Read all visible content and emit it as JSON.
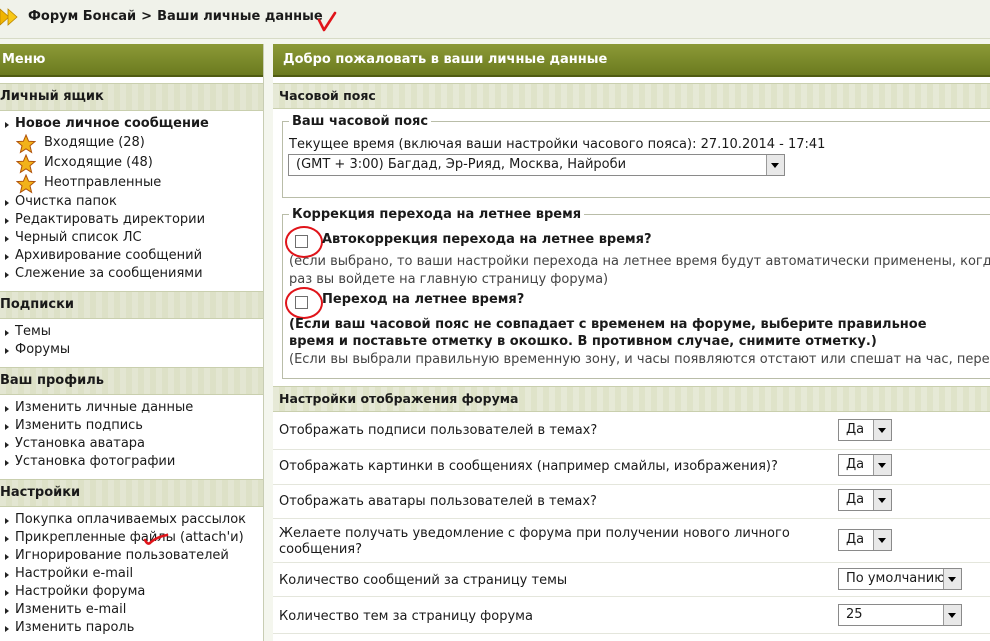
{
  "breadcrumb": {
    "forum": "Форум Бонсай",
    "separator": ">",
    "current": "Ваши личные данные"
  },
  "sidebar": {
    "title": "Меню",
    "sections": [
      {
        "title": "Личный ящик",
        "items": [
          "Новое личное сообщение",
          "Входящие (28)",
          "Исходящие (48)",
          "Неотправленные",
          "Очистка папок",
          "Редактировать директории",
          "Черный список ЛС",
          "Архивирование сообщений",
          "Слежение за сообщениями"
        ]
      },
      {
        "title": "Подписки",
        "items": [
          "Темы",
          "Форумы"
        ]
      },
      {
        "title": "Ваш профиль",
        "items": [
          "Изменить личные данные",
          "Изменить подпись",
          "Установка аватара",
          "Установка фотографии"
        ]
      },
      {
        "title": "Настройки",
        "items": [
          "Покупка оплачиваемых рассылок",
          "Прикрепленные файлы (attach'и)",
          "Игнорирование пользователей",
          "Настройки e-mail",
          "Настройки форума",
          "Изменить e-mail",
          "Изменить пароль"
        ]
      }
    ]
  },
  "main": {
    "title": "Добро пожаловать в ваши личные данные",
    "timezone_section": "Часовой пояс",
    "timezone_legend": "Ваш часовой пояс",
    "current_time": "Текущее время (включая ваши настройки часового пояса): 27.10.2014 - 17:41",
    "timezone_value": "(GMT + 3:00) Багдад, Эр-Рияд, Москва, Найроби",
    "dst_legend": "Коррекция перехода на летнее время",
    "auto_dst_label": "Автокоррекция перехода на летнее время?",
    "auto_dst_hint_1": "(если выбрано, то ваши настройки перехода на летнее время будут автоматически применены, когда в сле",
    "auto_dst_hint_2": "раз вы войдете на главную страницу форума)",
    "dst_label": "Переход на летнее время?",
    "dst_note_1": "(Если ваш часовой пояс не совпадает с временем на форуме, выберите правильное",
    "dst_note_2": "время и поставьте отметку в окошко. В противном случае, снимите отметку.)",
    "dst_hint": "(Если вы выбрали правильную временную зону, и часы появляются отстают или спешат на час, перепровер",
    "display_section": "Настройки отображения форума",
    "settings": [
      {
        "label": "Отображать подписи пользователей в темах?",
        "value": "Да"
      },
      {
        "label": "Отображать картинки в сообщениях (например смайлы, изображения)?",
        "value": "Да"
      },
      {
        "label": "Отображать аватары пользователей в темах?",
        "value": "Да"
      },
      {
        "label": "Желаете получать уведомление с форума при получении нового личного",
        "label2": "сообщения?",
        "value": "Да"
      },
      {
        "label": "Количество сообщений за страницу темы",
        "value": "По умолчанию"
      },
      {
        "label": "Количество тем за страницу форума",
        "value": "25"
      }
    ]
  },
  "colors": {
    "header_green": "#7a8a2a",
    "annotation_red": "#e0141a",
    "icons": [
      "arrow-icon",
      "star-icon",
      "checkmark-annotation"
    ]
  }
}
